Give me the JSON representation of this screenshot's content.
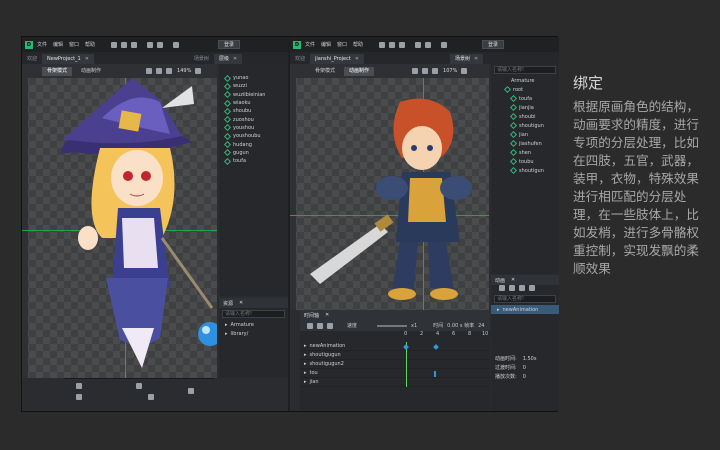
{
  "left_window": {
    "menu": [
      "文件",
      "编辑",
      "窗口",
      "帮助"
    ],
    "login": "登录",
    "tabs": [
      {
        "label": "欢迎"
      },
      {
        "label": "NewProject_1",
        "active": true
      }
    ],
    "modes": [
      "骨架模式",
      "动画制作"
    ],
    "zoom": "149%",
    "side_tabs": [
      "场景树",
      "层级"
    ],
    "assets": [
      "yunao",
      "wuzzi",
      "wuziibieinian",
      "wiaoku",
      "shoubu",
      "zuoshou",
      "youshou",
      "youshoubu",
      "hudang",
      "gugun",
      "toufa"
    ],
    "resource_panel": {
      "title": "资源",
      "search_placeholder": "请输入名称!",
      "tree": [
        "Armature",
        "library/"
      ]
    }
  },
  "right_window": {
    "menu": [
      "文件",
      "编辑",
      "窗口",
      "帮助"
    ],
    "login": "登录",
    "tabs": [
      {
        "label": "欢迎"
      },
      {
        "label": "jianshi_Project",
        "active": true
      }
    ],
    "modes": [
      "骨架模式",
      "动画制作"
    ],
    "zoom": "107%",
    "scene_tree": {
      "title": "场景树",
      "search_placeholder": "请输入名称!",
      "root_label": "Armature",
      "items": [
        "root",
        "toufa",
        "jianjia",
        "shoubi",
        "shoutigun",
        "jian",
        "jiashufen",
        "shen",
        "toubu",
        "shoutigun"
      ]
    },
    "animation_panel": {
      "title": "动画",
      "search_placeholder": "请输入名称!",
      "item": "newAnimation"
    },
    "timeline": {
      "title": "时间轴",
      "speed_label": "速度",
      "speed_value": "x1",
      "time_label": "时间",
      "time_value": "0.00 s 帧率",
      "fps": "24",
      "rows": [
        "newAnimation",
        "shoutigugun",
        "shoutigugun2",
        "tou",
        "jian"
      ],
      "ticks": [
        "0",
        "2",
        "4",
        "6",
        "8",
        "10"
      ],
      "props": [
        {
          "label": "动画时间:",
          "value": "1.50s"
        },
        {
          "label": "过渡时间:",
          "value": "0"
        },
        {
          "label": "播放次数:",
          "value": "0"
        }
      ]
    }
  },
  "caption": {
    "title": "绑定",
    "body": "根据原画角色的结构，动画要求的精度，进行专项的分层处理，比如在四肢，五官，武器，装甲，衣物，特殊效果进行相匹配的分层处理，在一些肢体上，比如发梢，进行多骨骼权重控制，实现发飘的柔顺效果"
  },
  "colors": {
    "bone": "#38b57f",
    "keyframe": "#2d9bd8",
    "accent_green": "#2f9e4b"
  }
}
